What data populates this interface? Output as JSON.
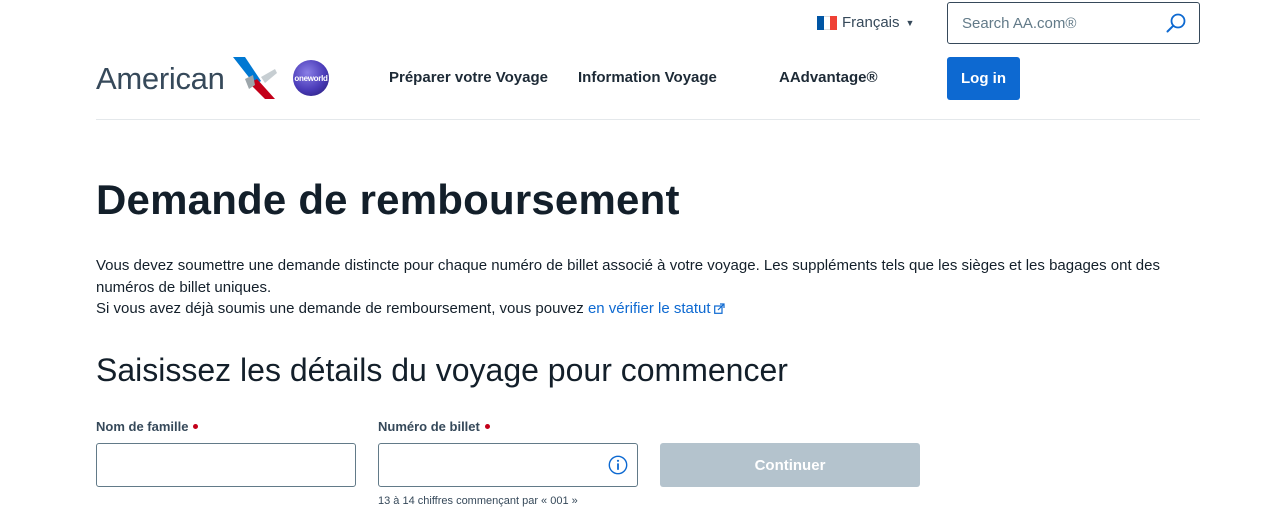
{
  "header": {
    "language": {
      "label": "Français",
      "flag_colors": [
        "#0055a4",
        "#ffffff",
        "#ef4135"
      ]
    },
    "search": {
      "placeholder": "Search AA.com®",
      "icon": "search-icon"
    },
    "logo": {
      "wordmark": "American",
      "alliance_badge": "oneworld",
      "colors": {
        "red": "#c30019",
        "blue": "#0078d2",
        "silver": "#9da6ab",
        "badge": "#4a3bb8"
      }
    },
    "nav": [
      {
        "label": "Préparer votre Voyage"
      },
      {
        "label": "Information Voyage"
      },
      {
        "label": "AAdvantage®"
      }
    ],
    "login_label": "Log in"
  },
  "main": {
    "title": "Demande de remboursement",
    "intro_line1": "Vous devez soumettre une demande distincte pour chaque numéro de billet associé à votre voyage. Les suppléments tels que les sièges et les bagages ont des numéros de billet uniques.",
    "intro_line2_prefix": "Si vous avez déjà soumis une demande de remboursement, vous pouvez ",
    "status_link": "en vérifier le statut",
    "form_title": "Saisissez les détails du voyage pour commencer",
    "form": {
      "last_name": {
        "label": "Nom de famille",
        "value": ""
      },
      "ticket_number": {
        "label": "Numéro de billet",
        "value": "",
        "hint": "13 à 14 chiffres commençant par « 001 »"
      },
      "continue_label": "Continuer"
    }
  },
  "colors": {
    "primary": "#0d69d1",
    "text_dark": "#131f2a",
    "text_muted": "#36495a",
    "required": "#c30019",
    "disabled_button": "#b4c3cd"
  }
}
